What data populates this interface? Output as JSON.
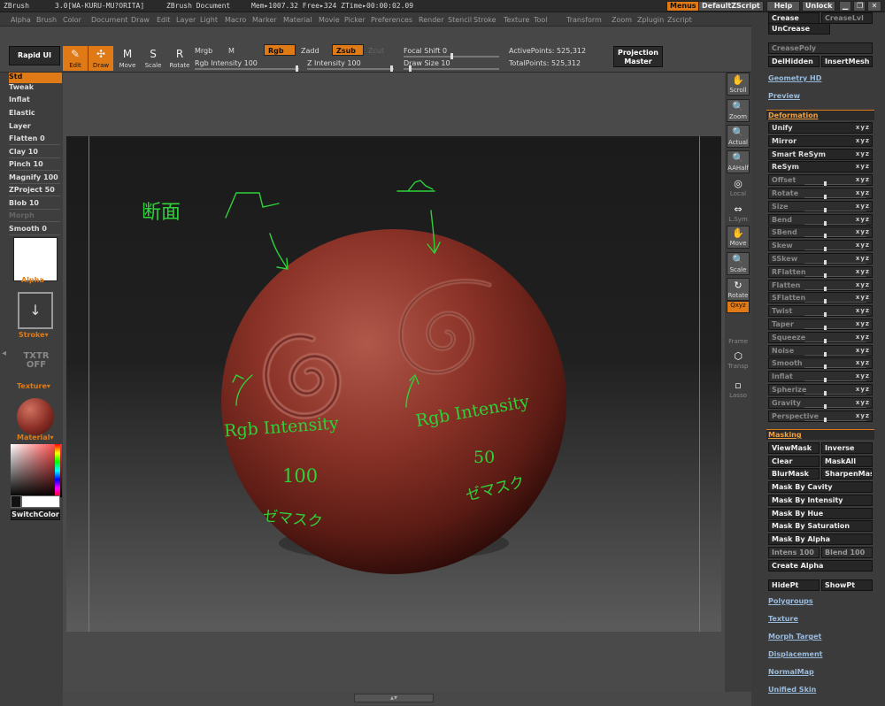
{
  "titlebar": {
    "app": "ZBrush",
    "version": "3.0[WA-KURU-MU?ORITA]",
    "doc": "ZBrush Document",
    "mem": "Mem▸1007.32 Free▸324 ZTime▸00:00:02.09",
    "menus": "Menus",
    "defaultzscript": "DefaultZScript",
    "help": "Help",
    "unlock": "Unlock"
  },
  "menubar": [
    "Alpha",
    "Brush",
    "Color",
    "Document",
    "Draw",
    "Edit",
    "Layer",
    "Light",
    "Macro",
    "Marker",
    "Material",
    "Movie",
    "Picker",
    "Preferences",
    "Render",
    "Stencil",
    "Stroke",
    "Texture",
    "Tool",
    "Transform",
    "Zoom",
    "Zplugin",
    "Zscript"
  ],
  "toolbar": {
    "rapid": "Rapid UI",
    "edit": "Edit",
    "draw": "Draw",
    "move": "Move",
    "scale": "Scale",
    "rotate": "Rotate",
    "mrgb": "Mrgb",
    "rgb": "Rgb",
    "m": "M",
    "zadd": "Zadd",
    "zsub": "Zsub",
    "zcut": "Zcut",
    "rgb_intensity": "Rgb Intensity 100",
    "z_intensity": "Z Intensity 100",
    "focal_shift": "Focal Shift 0",
    "draw_size": "Draw Size 10",
    "active_points": "ActivePoints: 525,312",
    "total_points": "TotalPoints: 525,312",
    "projection": "Projection",
    "master": "Master"
  },
  "left": {
    "tools": [
      "Std",
      "Tweak",
      "Inflat",
      "Elastic",
      "Layer",
      "Flatten 0",
      "Clay 10",
      "Pinch 10",
      "Magnify 100",
      "ZProject 50",
      "Blob 10",
      "Morph",
      "Smooth 0"
    ],
    "alpha": "Alpha",
    "stroke": "Stroke",
    "txtr": "TXTR OFF",
    "texture": "Texture",
    "material": "Material",
    "switchcolor": "SwitchColor"
  },
  "vstrip": [
    "Scroll",
    "Zoom",
    "Actual",
    "AAHalf",
    "Local",
    "L.Sym",
    "Move",
    "Scale",
    "Rotate",
    "Qxyz",
    "Frame",
    "Transp",
    "Lasso"
  ],
  "right": {
    "top": [
      "Crease",
      "CreaseLvl",
      "UnCrease",
      "CreasePoly",
      "Smooth",
      "DelHidden",
      "InsertMesh"
    ],
    "geometry_hd": "Geometry HD",
    "preview": "Preview",
    "deformation": "Deformation",
    "deform": [
      "Unify",
      "Mirror",
      "Smart ReSym",
      "ReSym",
      "Offset",
      "Rotate",
      "Size",
      "Bend",
      "SBend",
      "Skew",
      "SSkew",
      "RFlatten",
      "Flatten",
      "SFlatten",
      "Twist",
      "Taper",
      "Squeeze",
      "Noise",
      "Smooth",
      "Inflat",
      "Spherize",
      "Gravity",
      "Perspective"
    ],
    "masking": "Masking",
    "mask": [
      "ViewMask",
      "Inverse",
      "Clear",
      "MaskAll",
      "BlurMask",
      "SharpenMask",
      "Mask By Cavity",
      "Mask By Intensity",
      "Mask By Hue",
      "Mask By Saturation",
      "Mask By Alpha",
      "Intens 100",
      "Blend 100",
      "Create Alpha",
      "HidePt",
      "ShowPt"
    ],
    "sections": [
      "Polygroups",
      "Texture",
      "Morph Target",
      "Displacement",
      "NormalMap",
      "Unified Skin"
    ]
  },
  "annotations": {
    "danmen": "断面",
    "rgb1": "Rgb Intensity",
    "v1": "100",
    "b1": "ゼマスク",
    "rgb2": "Rgb Intensity",
    "v2": "50",
    "b2": "ゼマスク"
  },
  "colors": {
    "orange": "#e07a17",
    "sphere": "#8a2e25",
    "handwriting": "#2ed13a"
  }
}
